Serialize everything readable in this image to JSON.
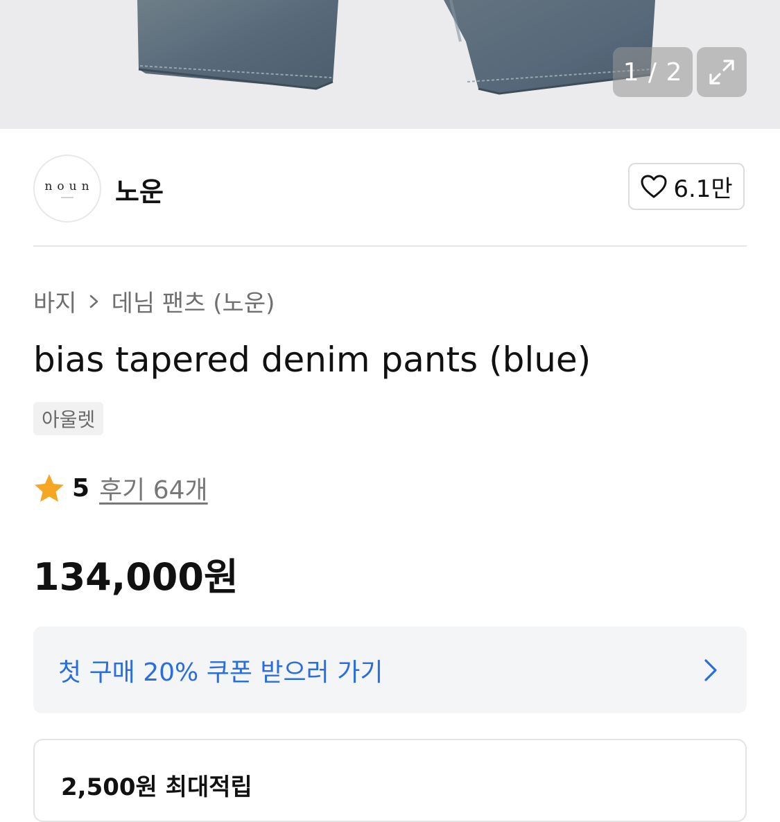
{
  "gallery": {
    "counter": "1 / 2",
    "expand_icon": "expand-icon"
  },
  "brand": {
    "logo_text": "noun",
    "name": "노운",
    "likes": "6.1만"
  },
  "breadcrumb": {
    "items": [
      "바지",
      "데님 팬츠 (노운)"
    ]
  },
  "product": {
    "title": "bias tapered denim pants (blue)",
    "tag": "아울렛",
    "rating": "5",
    "reviews": "후기 64개",
    "price": "134,000원"
  },
  "coupon": {
    "label": "첫 구매 20% 쿠폰 받으러 가기"
  },
  "points": {
    "text": "2,500원 최대적립"
  },
  "colors": {
    "accent_blue": "#2a6de0",
    "star": "#f5a623",
    "hero_bg": "#ebebed"
  }
}
